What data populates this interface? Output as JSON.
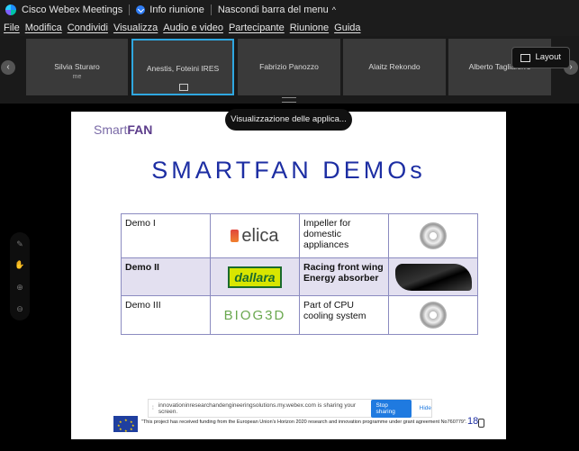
{
  "titlebar": {
    "app_title": "Cisco Webex Meetings",
    "info_label": "Info riunione",
    "hide_menu_label": "Nascondi barra del menu",
    "chevron": "^"
  },
  "menu": [
    "File",
    "Modifica",
    "Condividi",
    "Visualizza",
    "Audio e video",
    "Partecipante",
    "Riunione",
    "Guida"
  ],
  "participants": [
    {
      "name": "Silvia Sturaro",
      "sub": "me"
    },
    {
      "name": "Anestis, Foteini IRES",
      "sub": ""
    },
    {
      "name": "Fabrizio Panozzo",
      "sub": ""
    },
    {
      "name": "Alaitz Rekondo",
      "sub": ""
    },
    {
      "name": "Alberto Tagliaferro",
      "sub": ""
    }
  ],
  "strip": {
    "prev": "‹",
    "next": "›"
  },
  "layout_button": "Layout",
  "view_pill": "Visualizzazione delle applica...",
  "slide": {
    "brand_prefix": "Smart",
    "brand_suffix": "FAN",
    "title": "SMARTFAN DEMOs",
    "rows": [
      {
        "demo": "Demo I",
        "logo": "elica",
        "logo_sub": "",
        "desc_lines": [
          "Impeller for",
          "domestic",
          "appliances"
        ],
        "image": "fan-impeller"
      },
      {
        "demo": "Demo II",
        "logo": "dallara",
        "logo_sub": "",
        "desc_lines": [
          "Racing front wing",
          "Energy absorber"
        ],
        "image": "front-wing"
      },
      {
        "demo": "Demo III",
        "logo": "BIOG3D",
        "logo_sub": "",
        "desc_lines": [
          "Part of CPU",
          "cooling system"
        ],
        "image": "cpu-fan"
      }
    ],
    "funding": "\"This project has received funding from the European Union's Horizon 2020 research and innovation programme under grant agreement No760779\".",
    "page_number": "18"
  },
  "share_bar": {
    "text": "innovationinresearchandengineeringsolutions.my.webex.com is sharing your screen.",
    "stop_label": "Stop sharing",
    "hide_label": "Hide"
  },
  "colors": {
    "accent": "#2fa7e0",
    "title_blue": "#1d2ea3",
    "stop_blue": "#1f7ae0",
    "titlebar_bg": "#1c1c1c"
  }
}
